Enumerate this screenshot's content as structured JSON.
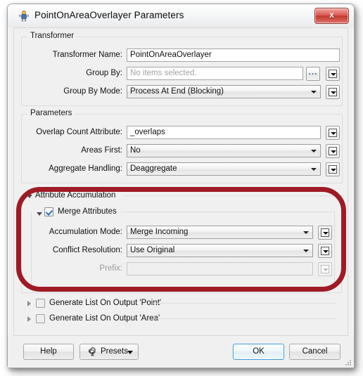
{
  "window": {
    "title": "PointOnAreaOverlayer Parameters",
    "icon": "transformer-icon",
    "close_label": "x"
  },
  "groups": {
    "transformer": {
      "legend": "Transformer"
    },
    "parameters": {
      "legend": "Parameters"
    },
    "attribute_accumulation": {
      "legend": "Attribute Accumulation"
    },
    "merge_attributes": {
      "legend": "Merge Attributes"
    }
  },
  "fields": {
    "transformer_name": {
      "label": "Transformer Name:",
      "value": "PointOnAreaOverlayer"
    },
    "group_by": {
      "label": "Group By:",
      "value": "",
      "placeholder": "No items selected.",
      "ellipsis": "..."
    },
    "group_by_mode": {
      "label": "Group By Mode:",
      "value": "Process At End (Blocking)"
    },
    "overlap_count_attribute": {
      "label": "Overlap Count Attribute:",
      "value": "_overlaps"
    },
    "areas_first": {
      "label": "Areas First:",
      "value": "No"
    },
    "aggregate_handling": {
      "label": "Aggregate Handling:",
      "value": "Deaggregate"
    },
    "accumulation_mode": {
      "label": "Accumulation Mode:",
      "value": "Merge Incoming"
    },
    "conflict_resolution": {
      "label": "Conflict Resolution:",
      "value": "Use Original"
    },
    "prefix": {
      "label": "Prefix:",
      "value": ""
    }
  },
  "checkboxes": {
    "merge_attributes": {
      "label": "Merge Attributes",
      "checked": true
    },
    "generate_list_point": {
      "label": "Generate List On Output 'Point'",
      "checked": false
    },
    "generate_list_area": {
      "label": "Generate List On Output 'Area'",
      "checked": false
    }
  },
  "buttons": {
    "help": "Help",
    "presets": "Presets",
    "ok": "OK",
    "cancel": "Cancel"
  },
  "colors": {
    "annotation_ring": "#9e1b26",
    "focus_border": "#3c9bd9",
    "close_button": "#c0392b"
  }
}
